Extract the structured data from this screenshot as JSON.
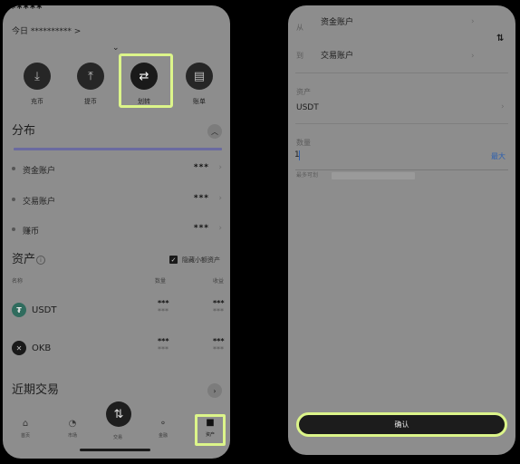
{
  "left": {
    "masked_balance": "*****",
    "today_label": "今日 ********** >",
    "expand_icon": "chevron-down-icon",
    "actions": [
      {
        "label": "充币",
        "icon": "deposit-icon"
      },
      {
        "label": "提币",
        "icon": "withdraw-icon"
      },
      {
        "label": "划转",
        "icon": "transfer-icon"
      },
      {
        "label": "账单",
        "icon": "bill-icon"
      }
    ],
    "distribution": {
      "title": "分布",
      "accounts": [
        {
          "name": "资金账户",
          "value": "***"
        },
        {
          "name": "交易账户",
          "value": "***"
        },
        {
          "name": "赚币",
          "value": "***"
        }
      ]
    },
    "assets": {
      "title": "资产",
      "hide_small_label": "隐藏小额资产",
      "columns": {
        "name": "名称",
        "quantity": "数量",
        "earnings": "收益"
      },
      "rows": [
        {
          "symbol": "USDT",
          "coin_icon": "usdt-icon",
          "qty_line1": "***",
          "qty_line2": "***",
          "val_line1": "***",
          "val_line2": "***"
        },
        {
          "symbol": "OKB",
          "coin_icon": "okb-icon",
          "qty_line1": "***",
          "qty_line2": "***",
          "val_line1": "***",
          "val_line2": "***"
        }
      ]
    },
    "recent": {
      "title": "近期交易"
    },
    "tabbar": [
      {
        "label": "首页",
        "icon": "home-icon"
      },
      {
        "label": "市场",
        "icon": "market-icon"
      },
      {
        "label": "交易",
        "icon": "trade-swap-icon"
      },
      {
        "label": "金融",
        "icon": "finance-icon"
      },
      {
        "label": "资产",
        "icon": "wallet-icon"
      }
    ],
    "highlight_color": "#dcf58a"
  },
  "right": {
    "from_label": "从",
    "from_account": "资金账户",
    "to_label": "到",
    "to_account": "交易账户",
    "swap_icon": "swap-vertical-icon",
    "asset_label": "资产",
    "asset_value": "USDT",
    "quantity_label": "数量",
    "quantity_value": "1",
    "max_label": "最大",
    "max_color": "#2c5fb0",
    "transferable_label": "最多可划",
    "confirm_label": "确认"
  }
}
